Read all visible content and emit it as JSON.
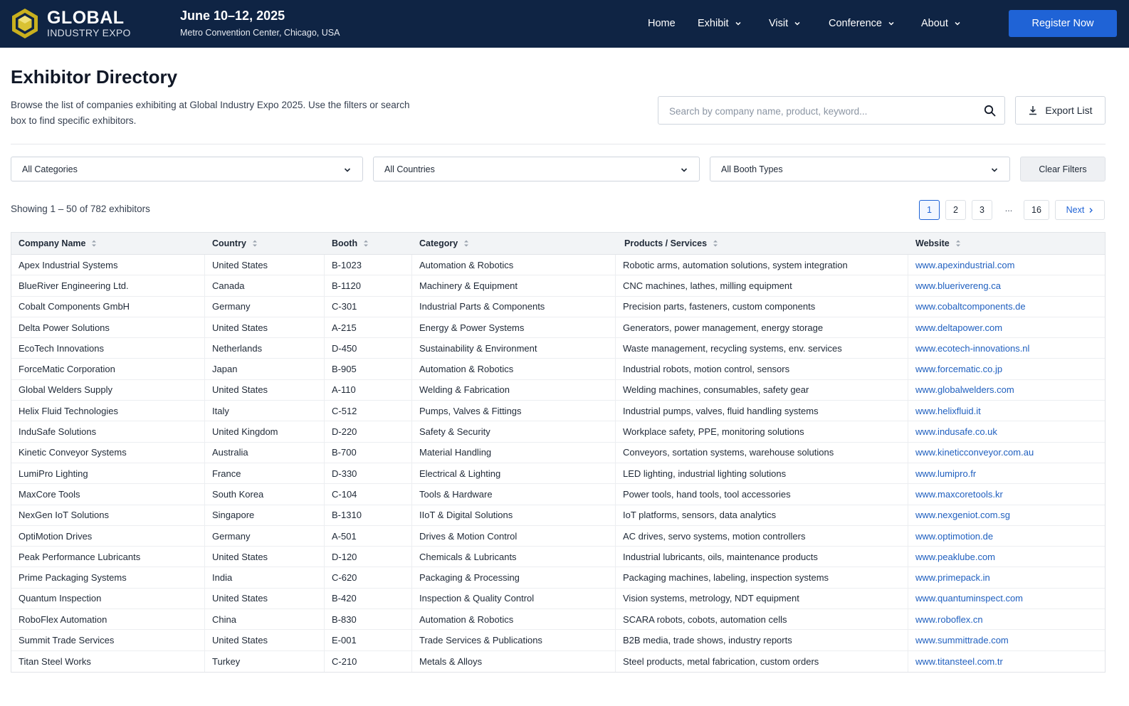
{
  "header": {
    "brand_line1": "GLOBAL",
    "brand_line2": "INDUSTRY EXPO",
    "event_dates": "June 10–12, 2025",
    "event_venue": "Metro Convention Center, Chicago, USA",
    "nav": [
      {
        "label": "Home"
      },
      {
        "label": "Exhibit"
      },
      {
        "label": "Visit"
      },
      {
        "label": "Conference"
      },
      {
        "label": "About"
      }
    ],
    "register_label": "Register Now",
    "colors": {
      "bar": "#0f2444",
      "accent": "#1f63d6",
      "logo": "#c9b01e"
    }
  },
  "page": {
    "title": "Exhibitor Directory",
    "description": "Browse the list of companies exhibiting at Global Industry Expo 2025. Use the filters or search box to find specific exhibitors.",
    "search_placeholder": "Search by company name, product, keyword...",
    "export_label": "Export List"
  },
  "filters": {
    "category": "All Categories",
    "country": "All Countries",
    "booth_type": "All Booth Types",
    "clear_label": "Clear Filters"
  },
  "results": {
    "showing_text": "Showing 1 – 50 of 782 exhibitors",
    "pages": [
      "1",
      "2",
      "3",
      "16"
    ],
    "current_page": "1",
    "ellipsis": "...",
    "next_label": "Next"
  },
  "table": {
    "columns": [
      "Company Name",
      "Country",
      "Booth",
      "Category",
      "Products / Services",
      "Website"
    ],
    "rows": [
      [
        "Apex Industrial Systems",
        "United States",
        "B-1023",
        "Automation & Robotics",
        "Robotic arms, automation solutions, system integration",
        "www.apexindustrial.com"
      ],
      [
        "BlueRiver Engineering Ltd.",
        "Canada",
        "B-1120",
        "Machinery & Equipment",
        "CNC machines, lathes, milling equipment",
        "www.bluerivereng.ca"
      ],
      [
        "Cobalt Components GmbH",
        "Germany",
        "C-301",
        "Industrial Parts & Components",
        "Precision parts, fasteners, custom components",
        "www.cobaltcomponents.de"
      ],
      [
        "Delta Power Solutions",
        "United States",
        "A-215",
        "Energy & Power Systems",
        "Generators, power management, energy storage",
        "www.deltapower.com"
      ],
      [
        "EcoTech Innovations",
        "Netherlands",
        "D-450",
        "Sustainability & Environment",
        "Waste management, recycling systems, env. services",
        "www.ecotech-innovations.nl"
      ],
      [
        "ForceMatic Corporation",
        "Japan",
        "B-905",
        "Automation & Robotics",
        "Industrial robots, motion control, sensors",
        "www.forcematic.co.jp"
      ],
      [
        "Global Welders Supply",
        "United States",
        "A-110",
        "Welding & Fabrication",
        "Welding machines, consumables, safety gear",
        "www.globalwelders.com"
      ],
      [
        "Helix Fluid Technologies",
        "Italy",
        "C-512",
        "Pumps, Valves & Fittings",
        "Industrial pumps, valves, fluid handling systems",
        "www.helixfluid.it"
      ],
      [
        "InduSafe Solutions",
        "United Kingdom",
        "D-220",
        "Safety & Security",
        "Workplace safety, PPE, monitoring solutions",
        "www.indusafe.co.uk"
      ],
      [
        "Kinetic Conveyor Systems",
        "Australia",
        "B-700",
        "Material Handling",
        "Conveyors, sortation systems, warehouse solutions",
        "www.kineticconveyor.com.au"
      ],
      [
        "LumiPro Lighting",
        "France",
        "D-330",
        "Electrical & Lighting",
        "LED lighting, industrial lighting solutions",
        "www.lumipro.fr"
      ],
      [
        "MaxCore Tools",
        "South Korea",
        "C-104",
        "Tools & Hardware",
        "Power tools, hand tools, tool accessories",
        "www.maxcoretools.kr"
      ],
      [
        "NexGen IoT Solutions",
        "Singapore",
        "B-1310",
        "IIoT & Digital Solutions",
        "IoT platforms, sensors, data analytics",
        "www.nexgeniot.com.sg"
      ],
      [
        "OptiMotion Drives",
        "Germany",
        "A-501",
        "Drives & Motion Control",
        "AC drives, servo systems, motion controllers",
        "www.optimotion.de"
      ],
      [
        "Peak Performance Lubricants",
        "United States",
        "D-120",
        "Chemicals & Lubricants",
        "Industrial lubricants, oils, maintenance products",
        "www.peaklube.com"
      ],
      [
        "Prime Packaging Systems",
        "India",
        "C-620",
        "Packaging & Processing",
        "Packaging machines, labeling, inspection systems",
        "www.primepack.in"
      ],
      [
        "Quantum Inspection",
        "United States",
        "B-420",
        "Inspection & Quality Control",
        "Vision systems, metrology, NDT equipment",
        "www.quantuminspect.com"
      ],
      [
        "RoboFlex Automation",
        "China",
        "B-830",
        "Automation & Robotics",
        "SCARA robots, cobots, automation cells",
        "www.roboflex.cn"
      ],
      [
        "Summit Trade Services",
        "United States",
        "E-001",
        "Trade Services & Publications",
        "B2B media, trade shows, industry reports",
        "www.summittrade.com"
      ],
      [
        "Titan Steel Works",
        "Turkey",
        "C-210",
        "Metals & Alloys",
        "Steel products, metal fabrication, custom orders",
        "www.titansteel.com.tr"
      ]
    ]
  }
}
